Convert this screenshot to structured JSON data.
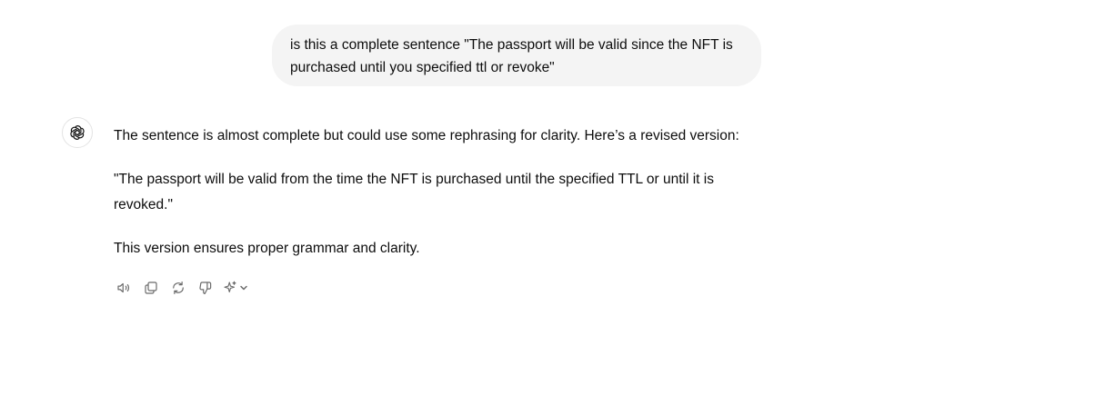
{
  "conversation": {
    "user_message": "is this a complete sentence \"The passport will be valid since the NFT is purchased until you specified ttl or revoke\"",
    "assistant": {
      "paragraph_1": "The sentence is almost complete but could use some rephrasing for clarity. Here’s a revised version:",
      "paragraph_2": "\"The passport will be valid from the time the NFT is purchased until the specified TTL or until it is revoked.\"",
      "paragraph_3": "This version ensures proper grammar and clarity."
    }
  },
  "actions": {
    "icons": [
      "speaker-icon",
      "copy-icon",
      "regenerate-icon",
      "thumbs-down-icon",
      "sparkle-icon",
      "chevron-down-icon"
    ]
  },
  "colors": {
    "user_bubble_bg": "#f4f4f4",
    "icon_gray": "#6b6b6b",
    "text": "#0d0d0d"
  }
}
